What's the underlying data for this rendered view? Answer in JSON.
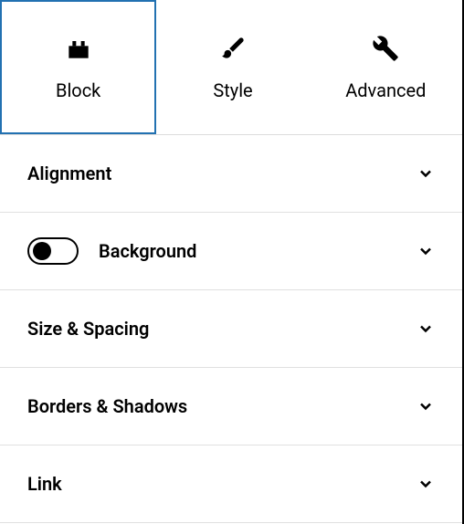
{
  "tabs": {
    "block": {
      "label": "Block"
    },
    "style": {
      "label": "Style"
    },
    "advanced": {
      "label": "Advanced"
    }
  },
  "sections": {
    "alignment": {
      "label": "Alignment"
    },
    "background": {
      "label": "Background"
    },
    "size_spacing": {
      "label": "Size & Spacing"
    },
    "borders_shadows": {
      "label": "Borders & Shadows"
    },
    "link": {
      "label": "Link"
    }
  }
}
